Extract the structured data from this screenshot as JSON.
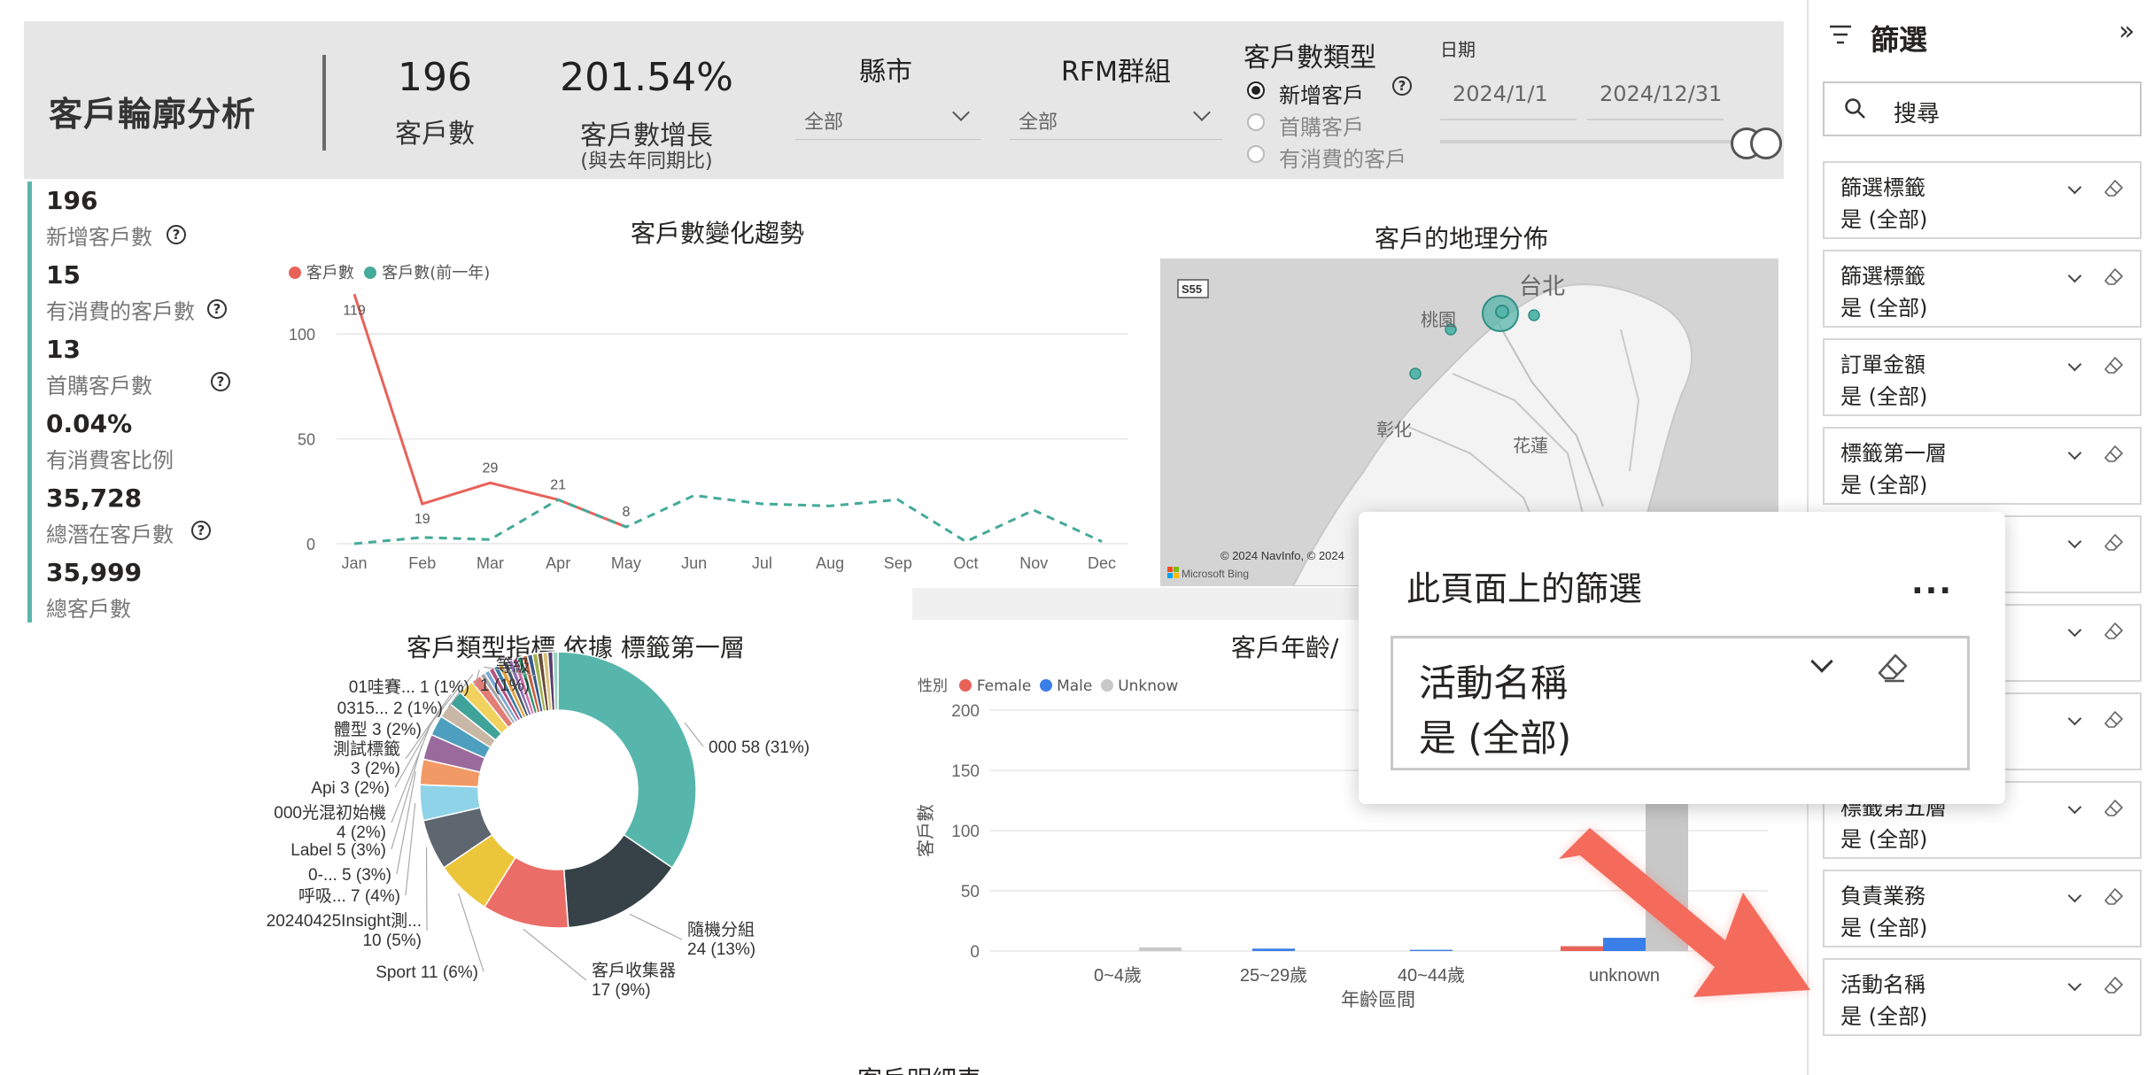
{
  "header": {
    "app_title": "客戶輪廓分析",
    "kpi_customers": {
      "value": "196",
      "label": "客戶數"
    },
    "kpi_growth": {
      "value": "201.54%",
      "label": "客戶數增長",
      "sublabel": "(與去年同期比)"
    },
    "slicer_city": {
      "title": "縣市",
      "selected": "全部"
    },
    "slicer_rfm": {
      "title": "RFM群組",
      "selected": "全部"
    },
    "slicer_type": {
      "title": "客戶數類型",
      "options": [
        "新增客戶",
        "首購客戶",
        "有消費的客戶"
      ],
      "selected_index": 0
    },
    "date": {
      "label": "日期",
      "start": "2024/1/1",
      "end": "2024/12/31"
    }
  },
  "side_kpis": [
    {
      "value": "196",
      "label": "新增客戶數",
      "help": true
    },
    {
      "value": "15",
      "label": "有消費的客戶數",
      "help": true
    },
    {
      "value": "13",
      "label": "首購客戶數",
      "help": true
    },
    {
      "value": "0.04%",
      "label": "有消費客比例",
      "help": false
    },
    {
      "value": "35,728",
      "label": "總潛在客戶數",
      "help": true
    },
    {
      "value": "35,999",
      "label": "總客戶數",
      "help": false
    }
  ],
  "trend_chart": {
    "title": "客戶數變化趨勢",
    "legend": [
      "客戶數",
      "客戶數(前一年)"
    ]
  },
  "map": {
    "title": "客戶的地理分佈",
    "labels": [
      "台北",
      "桃園",
      "彰化",
      "花蓮",
      "S55"
    ],
    "attribution": "© 2024 NavInfo, © 2024",
    "bing": "Microsoft Bing"
  },
  "donut_chart": {
    "title": "客戶類型指標 依據 標籤第一層"
  },
  "age_chart": {
    "title": "客戶年齡/",
    "legend_title": "性別",
    "legend": [
      "Female",
      "Male",
      "Unknow"
    ],
    "ylabel": "客戶數",
    "xlabel": "年齡區間"
  },
  "chart_data": [
    {
      "type": "line",
      "title": "客戶數變化趨勢",
      "x": [
        "Jan",
        "Feb",
        "Mar",
        "Apr",
        "May",
        "Jun",
        "Jul",
        "Aug",
        "Sep",
        "Oct",
        "Nov",
        "Dec"
      ],
      "yticks": [
        0,
        50,
        100
      ],
      "ylim": [
        0,
        125
      ],
      "series": [
        {
          "name": "客戶數",
          "color": "#e8625a",
          "style": "solid",
          "values": [
            119,
            19,
            29,
            21,
            8,
            null,
            null,
            null,
            null,
            null,
            null,
            null
          ],
          "labels": [
            "119",
            "19",
            "29",
            "21",
            "8"
          ]
        },
        {
          "name": "客戶數(前一年)",
          "color": "#44aa99",
          "style": "dashed",
          "values": [
            0,
            3,
            2,
            21,
            8,
            23,
            19,
            18,
            21,
            1,
            16,
            1
          ]
        }
      ],
      "grid": true
    },
    {
      "type": "pie",
      "title": "客戶類型指標 依據 標籤第一層",
      "slices": [
        {
          "label": "000",
          "value": 58,
          "text": "000 58 (31%)",
          "color": "#57b6ab"
        },
        {
          "label": "隨機分組",
          "value": 24,
          "text": "隨機分組 24 (13%)",
          "color": "#364247"
        },
        {
          "label": "客戶收集器",
          "value": 17,
          "text": "客戶收集器 17 (9%)",
          "color": "#eb6d68"
        },
        {
          "label": "Sport",
          "value": 11,
          "text": "Sport 11 (6%)",
          "color": "#ecc63a"
        },
        {
          "label": "20240425Insight測...",
          "value": 10,
          "text": "20240425Insight測... 10 (5%)",
          "color": "#5e6670"
        },
        {
          "label": "呼吸...",
          "value": 7,
          "text": "呼吸... 7 (4%)",
          "color": "#8fd3e8"
        },
        {
          "label": "0-...",
          "value": 5,
          "text": "0-... 5 (3%)",
          "color": "#f29a66"
        },
        {
          "label": "Label",
          "value": 5,
          "text": "Label 5 (3%)",
          "color": "#9b6a9c"
        },
        {
          "label": "000光混初始機",
          "value": 4,
          "text": "000光混初始機 4 (2%)",
          "color": "#4e9fbf"
        },
        {
          "label": "Api",
          "value": 3,
          "text": "Api 3 (2%)",
          "color": "#c9b7a6"
        },
        {
          "label": "測試標籤",
          "value": 3,
          "text": "測試標籤 3 (2%)",
          "color": "#40a39a"
        },
        {
          "label": "體型",
          "value": 3,
          "text": "體型 3 (2%)",
          "color": "#f2d25e"
        },
        {
          "label": "0315...",
          "value": 2,
          "text": "0315... 2 (1%)",
          "color": "#e27d76"
        },
        {
          "label": "01哇賽...",
          "value": 1,
          "text": "01哇賽... 1 (1%)",
          "color": "#a6a6a6"
        },
        {
          "label": "等級",
          "value": 1,
          "text": "等級 1 (1%)",
          "color": "#7aa8d4"
        },
        {
          "label": "",
          "value": 1,
          "text": "",
          "color": "#b5527f"
        },
        {
          "label": "",
          "value": 1,
          "text": "",
          "color": "#3c7da3"
        },
        {
          "label": "",
          "value": 1,
          "text": "",
          "color": "#e5a03c"
        },
        {
          "label": "",
          "value": 1,
          "text": "",
          "color": "#4a5a68"
        },
        {
          "label": "",
          "value": 1,
          "text": "",
          "color": "#8b6fb3"
        },
        {
          "label": "",
          "value": 1,
          "text": "",
          "color": "#d46aa8"
        },
        {
          "label": "",
          "value": 1,
          "text": "",
          "color": "#2f8f6f"
        },
        {
          "label": "",
          "value": 1,
          "text": "",
          "color": "#c7603a"
        },
        {
          "label": "",
          "value": 1,
          "text": "",
          "color": "#395b8c"
        },
        {
          "label": "",
          "value": 1,
          "text": "",
          "color": "#a0b04a"
        },
        {
          "label": "",
          "value": 1,
          "text": "",
          "color": "#6a4c3a"
        },
        {
          "label": "",
          "value": 1,
          "text": "",
          "color": "#d9c27a"
        },
        {
          "label": "",
          "value": 1,
          "text": "",
          "color": "#5a3d6e"
        },
        {
          "label": "",
          "value": 1,
          "text": "",
          "color": "#9ad0c2"
        }
      ]
    },
    {
      "type": "bar",
      "title": "客戶年齡/",
      "categories": [
        "0~4歲",
        "25~29歲",
        "40~44歲",
        "unknown"
      ],
      "series": [
        {
          "name": "Female",
          "color": "#e8625a",
          "values": [
            0,
            0,
            0,
            4
          ]
        },
        {
          "name": "Male",
          "color": "#3a7ee8",
          "values": [
            0,
            2,
            1,
            11
          ]
        },
        {
          "name": "Unknow",
          "color": "#c8c8c8",
          "values": [
            3,
            0,
            0,
            180
          ]
        }
      ],
      "yticks": [
        0,
        50,
        100,
        150,
        200
      ],
      "ylim": [
        0,
        200
      ],
      "xlabel": "年齡區間",
      "ylabel": "客戶數",
      "grid": true
    }
  ],
  "filter_pane": {
    "title": "篩選",
    "collapse_icon": "»",
    "search_placeholder": "搜尋",
    "cards": [
      {
        "name": "篩選標籤",
        "value": "是 (全部)"
      },
      {
        "name": "篩選標籤",
        "value": "是 (全部)"
      },
      {
        "name": "訂單金額",
        "value": "是 (全部)"
      },
      {
        "name": "標籤第一層",
        "value": "是 (全部)"
      },
      {
        "name": "",
        "value": ""
      },
      {
        "name": "",
        "value": ""
      },
      {
        "name": "",
        "value": ""
      },
      {
        "name": "標籤第五層",
        "value": "是 (全部)"
      },
      {
        "name": "負責業務",
        "value": "是 (全部)"
      },
      {
        "name": "活動名稱",
        "value": "是 (全部)"
      }
    ]
  },
  "popup": {
    "title": "此頁面上的篩選",
    "more": "...",
    "card_name": "活動名稱",
    "card_value": "是 (全部)"
  },
  "table": {
    "title": "客戶明細表"
  },
  "colors": {
    "teal": "#57b6ab",
    "red": "#e8625a",
    "blue": "#3a7ee8",
    "arrow": "#f46b5c"
  }
}
